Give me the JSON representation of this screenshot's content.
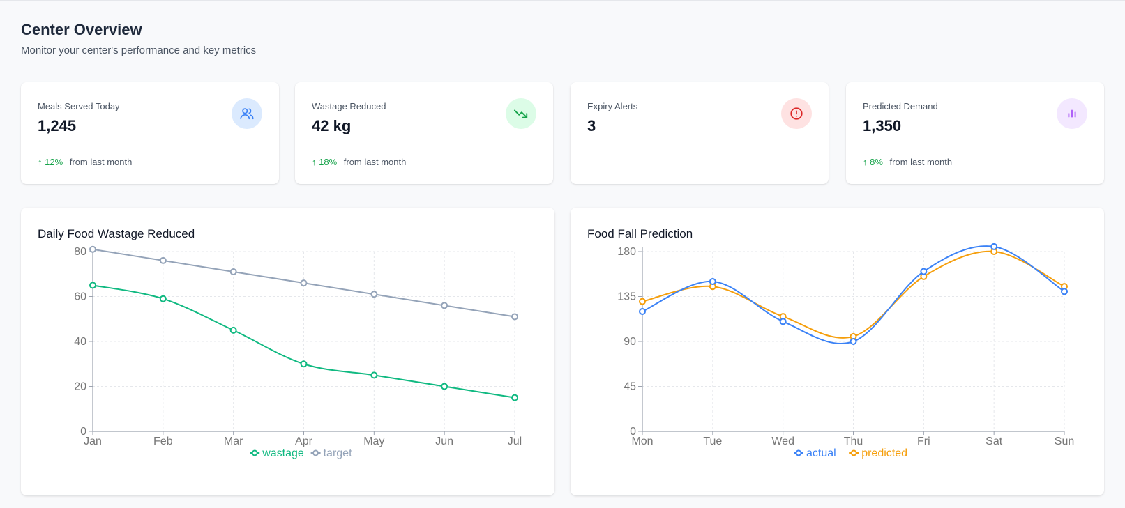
{
  "header": {
    "title": "Center Overview",
    "subtitle": "Monitor your center's performance and key metrics"
  },
  "stats": [
    {
      "label": "Meals Served Today",
      "value": "1,245",
      "trend_pct": "↑ 12%",
      "trend_text": "from last month",
      "icon": "users-icon",
      "icon_color": "#3b82f6",
      "icon_bg": "#dbeafe"
    },
    {
      "label": "Wastage Reduced",
      "value": "42 kg",
      "trend_pct": "↑ 18%",
      "trend_text": "from last month",
      "icon": "trending-down-icon",
      "icon_color": "#16a34a",
      "icon_bg": "#dcfce7"
    },
    {
      "label": "Expiry Alerts",
      "value": "3",
      "icon": "alert-circle-icon",
      "icon_color": "#dc2626",
      "icon_bg": "#fee2e2"
    },
    {
      "label": "Predicted Demand",
      "value": "1,350",
      "trend_pct": "↑ 8%",
      "trend_text": "from last month",
      "icon": "bar-chart-icon",
      "icon_color": "#a855f7",
      "icon_bg": "#f3e8ff"
    }
  ],
  "charts": {
    "wastage_title": "Daily Food Wastage Reduced",
    "prediction_title": "Food Fall Prediction"
  },
  "chart_data": [
    {
      "type": "line",
      "title": "Daily Food Wastage Reduced",
      "categories": [
        "Jan",
        "Feb",
        "Mar",
        "Apr",
        "May",
        "Jun",
        "Jul"
      ],
      "ylim": [
        0,
        80
      ],
      "yticks": [
        0,
        20,
        40,
        60,
        80
      ],
      "grid": true,
      "legend": "bottom",
      "smooth": true,
      "series": [
        {
          "name": "wastage",
          "color": "#10b981",
          "values": [
            65,
            59,
            45,
            30,
            25,
            20,
            15
          ]
        },
        {
          "name": "target",
          "color": "#94a3b8",
          "values": [
            81,
            76,
            71,
            66,
            61,
            56,
            51
          ]
        }
      ]
    },
    {
      "type": "line",
      "title": "Food Fall Prediction",
      "categories": [
        "Mon",
        "Tue",
        "Wed",
        "Thu",
        "Fri",
        "Sat",
        "Sun"
      ],
      "ylim": [
        0,
        180
      ],
      "yticks": [
        0,
        45,
        90,
        135,
        180
      ],
      "grid": true,
      "legend": "bottom",
      "smooth": true,
      "series": [
        {
          "name": "actual",
          "color": "#3b82f6",
          "values": [
            120,
            150,
            110,
            90,
            160,
            185,
            140
          ]
        },
        {
          "name": "predicted",
          "color": "#f59e0b",
          "values": [
            130,
            145,
            115,
            95,
            155,
            180,
            145
          ]
        }
      ]
    }
  ]
}
